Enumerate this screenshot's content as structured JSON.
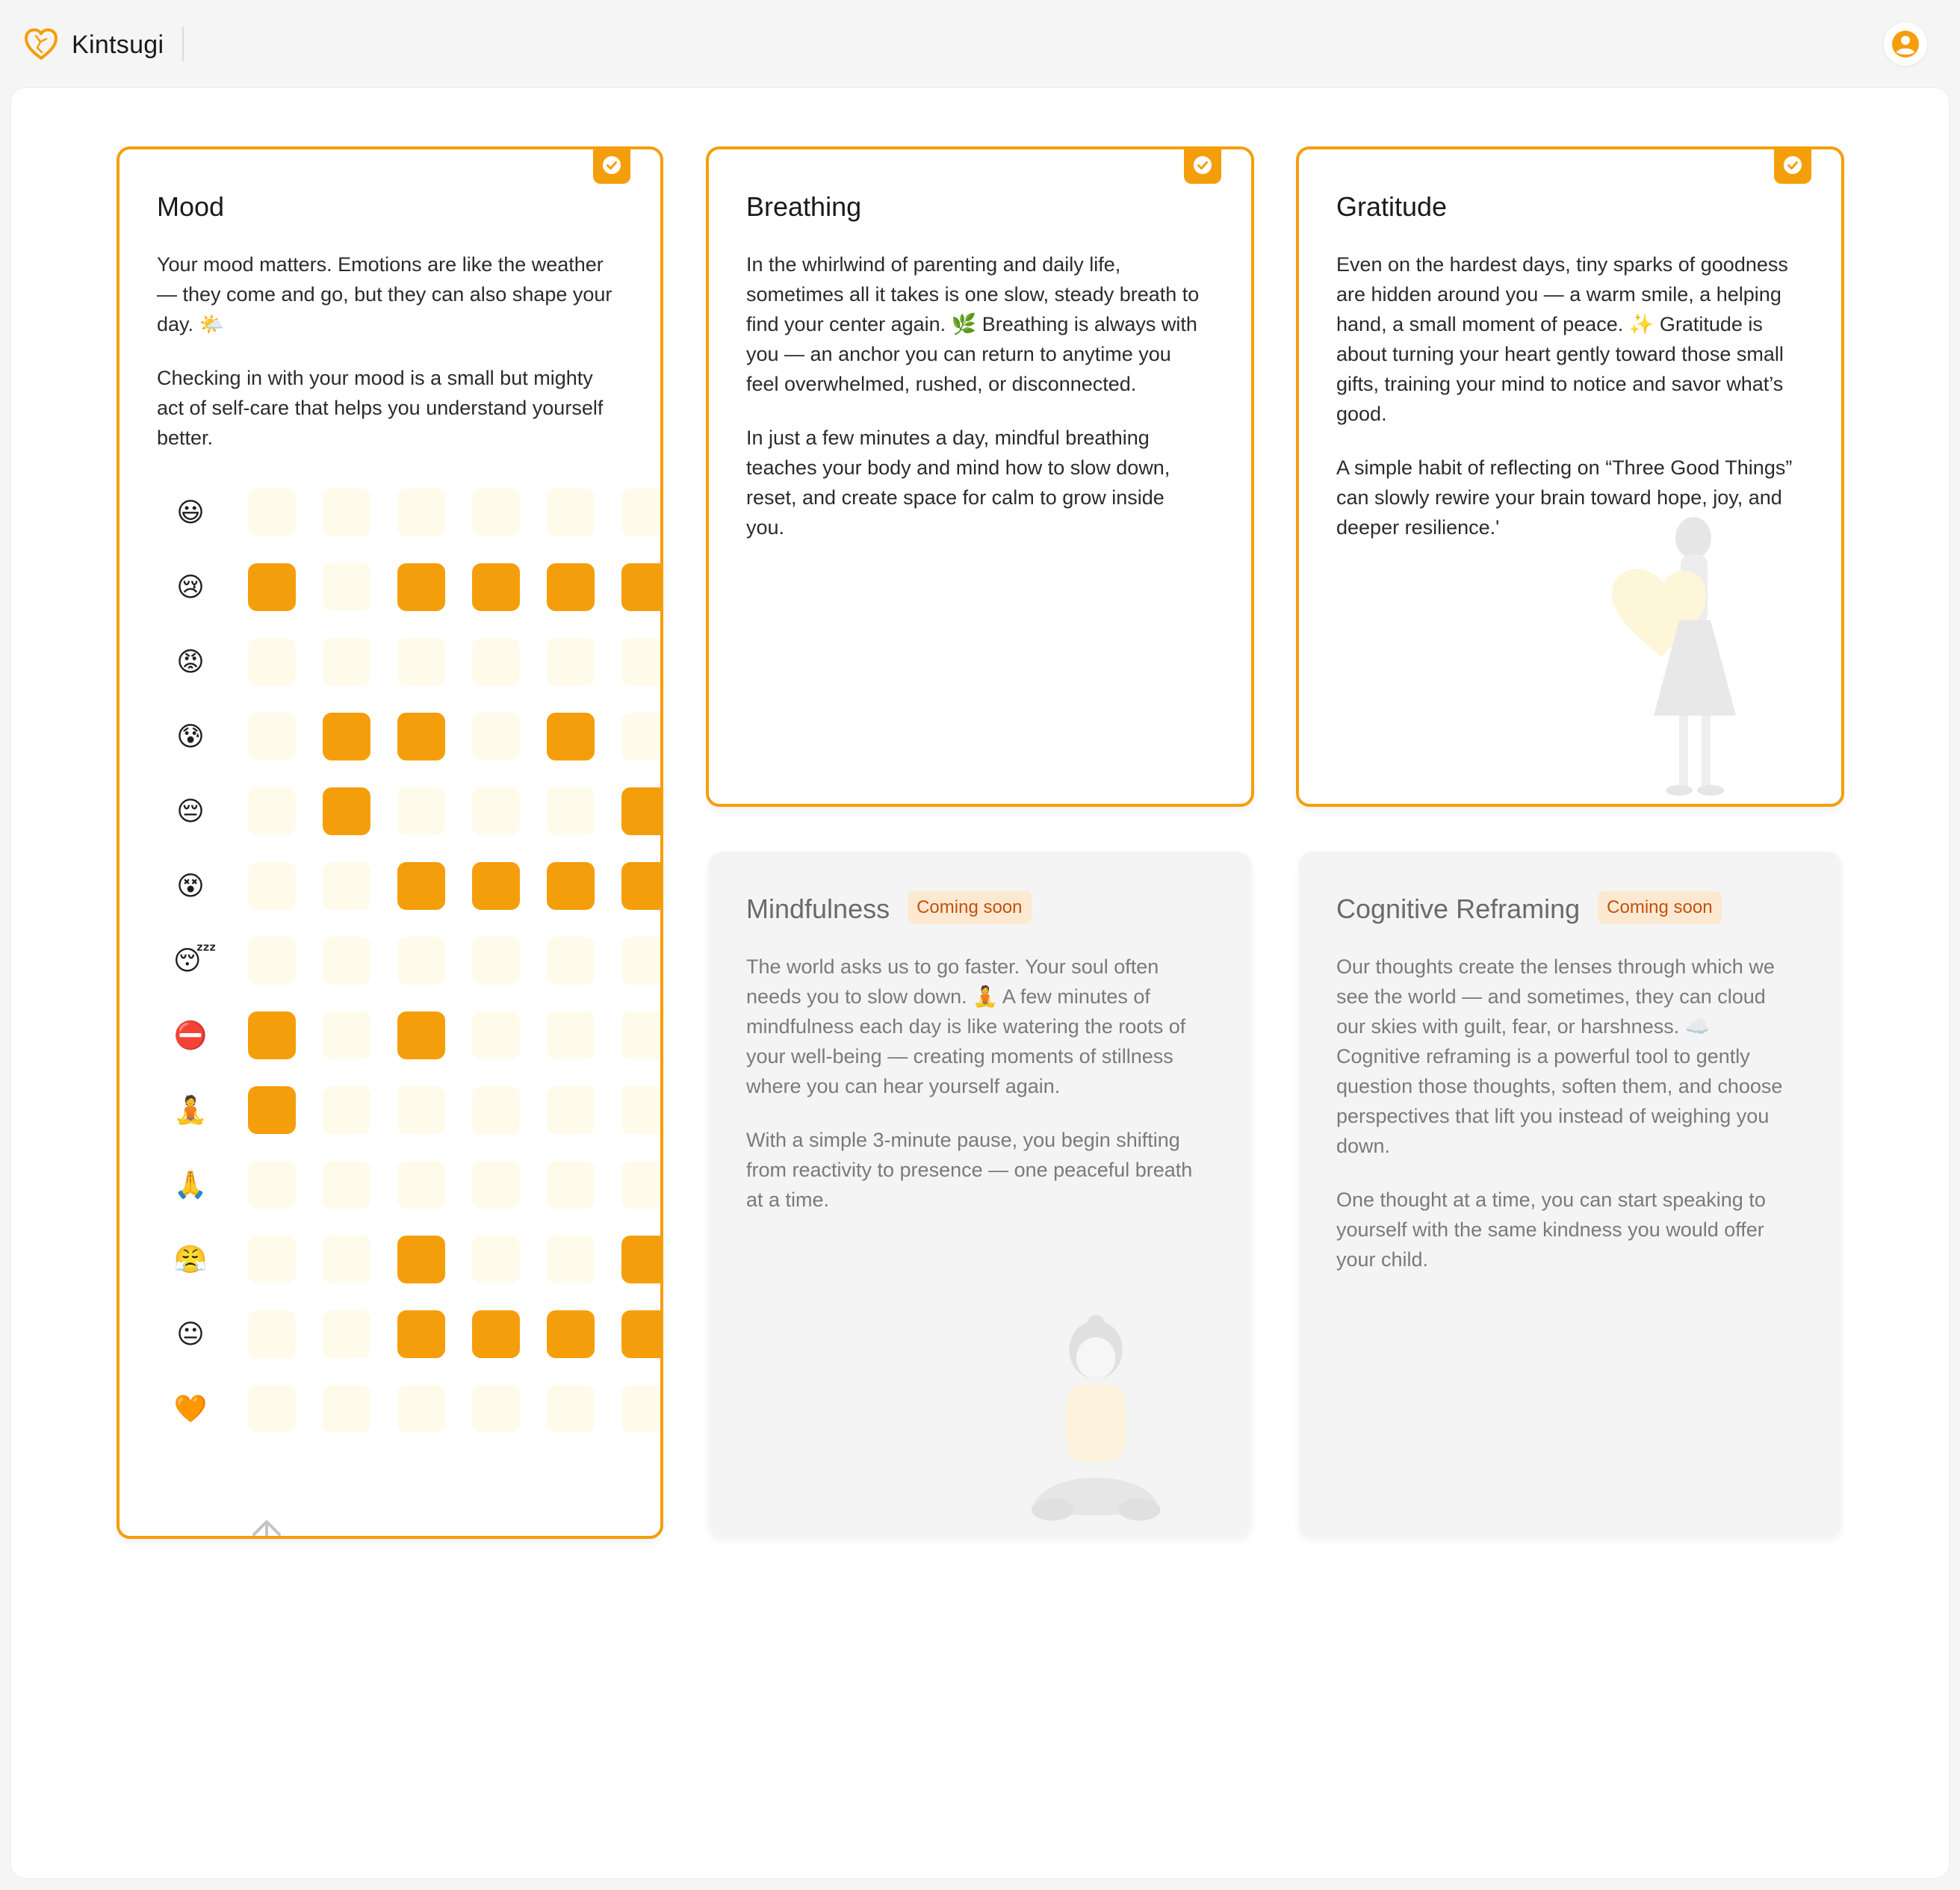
{
  "app": {
    "name": "Kintsugi"
  },
  "icons": {
    "logo": "heart-logo-icon",
    "account": "user-circle-icon",
    "check": "check-circle-icon",
    "scroll": "arrow-up-icon"
  },
  "colors": {
    "accent": "#f59e0b",
    "cell_empty": "#fffbea",
    "badge_bg": "#fde9d2",
    "badge_text": "#c2510c"
  },
  "cards": {
    "mood": {
      "title": "Mood",
      "completed": true,
      "paragraphs": [
        "Your mood matters. Emotions are like the weather — they come and go, but they can also shape your day. 🌤️",
        "Checking in with your mood is a small but mighty act of self-care that helps you understand yourself better."
      ],
      "tracker": [
        {
          "emoji": "😃",
          "cells": [
            0,
            0,
            0,
            0,
            0,
            0
          ]
        },
        {
          "emoji": "😢",
          "cells": [
            1,
            0,
            1,
            1,
            1,
            1
          ]
        },
        {
          "emoji": "😡",
          "cells": [
            0,
            0,
            0,
            0,
            0,
            0
          ]
        },
        {
          "emoji": "😰",
          "cells": [
            0,
            1,
            1,
            0,
            1,
            0
          ]
        },
        {
          "emoji": "😔",
          "cells": [
            0,
            1,
            0,
            0,
            0,
            1
          ]
        },
        {
          "emoji": "😵",
          "cells": [
            0,
            0,
            1,
            1,
            1,
            1
          ]
        },
        {
          "emoji": "😴",
          "cells": [
            0,
            0,
            0,
            0,
            0,
            0
          ]
        },
        {
          "emoji": "⛔",
          "cells": [
            1,
            0,
            1,
            0,
            0,
            0
          ]
        },
        {
          "emoji": "🧘",
          "cells": [
            1,
            0,
            0,
            0,
            0,
            0
          ]
        },
        {
          "emoji": "🙏",
          "cells": [
            0,
            0,
            0,
            0,
            0,
            0
          ]
        },
        {
          "emoji": "😤",
          "cells": [
            0,
            0,
            1,
            0,
            0,
            1
          ]
        },
        {
          "emoji": "😐",
          "cells": [
            0,
            0,
            1,
            1,
            1,
            1
          ]
        },
        {
          "emoji": "🧡",
          "cells": [
            0,
            0,
            0,
            0,
            0,
            0
          ]
        }
      ]
    },
    "breathing": {
      "title": "Breathing",
      "completed": true,
      "paragraphs": [
        "In the whirlwind of parenting and daily life, sometimes all it takes is one slow, steady breath to find your center again. 🌿 Breathing is always with you — an anchor you can return to anytime you feel overwhelmed, rushed, or disconnected.",
        "In just a few minutes a day, mindful breathing teaches your body and mind how to slow down, reset, and create space for calm to grow inside you."
      ]
    },
    "gratitude": {
      "title": "Gratitude",
      "completed": true,
      "paragraphs": [
        "Even on the hardest days, tiny sparks of goodness are hidden around you — a warm smile, a helping hand, a small moment of peace. ✨ Gratitude is about turning your heart gently toward those small gifts, training your mind to notice and savor what’s good.",
        "A simple habit of reflecting on “Three Good Things” can slowly rewire your brain toward hope, joy, and deeper resilience.'"
      ]
    },
    "mindfulness": {
      "title": "Mindfulness",
      "badge": "Coming soon",
      "paragraphs": [
        "The world asks us to go faster. Your soul often needs you to slow down. 🧘 A few minutes of mindfulness each day is like watering the roots of your well-being — creating moments of stillness where you can hear yourself again.",
        "With a simple 3-minute pause, you begin shifting from reactivity to presence — one peaceful breath at a time."
      ]
    },
    "reframing": {
      "title": "Cognitive Reframing",
      "badge": "Coming soon",
      "paragraphs": [
        "Our thoughts create the lenses through which we see the world — and sometimes, they can cloud our skies with guilt, fear, or harshness. ☁️ Cognitive reframing is a powerful tool to gently question those thoughts, soften them, and choose perspectives that lift you instead of weighing you down.",
        "One thought at a time, you can start speaking to yourself with the same kindness you would offer your child."
      ]
    }
  }
}
